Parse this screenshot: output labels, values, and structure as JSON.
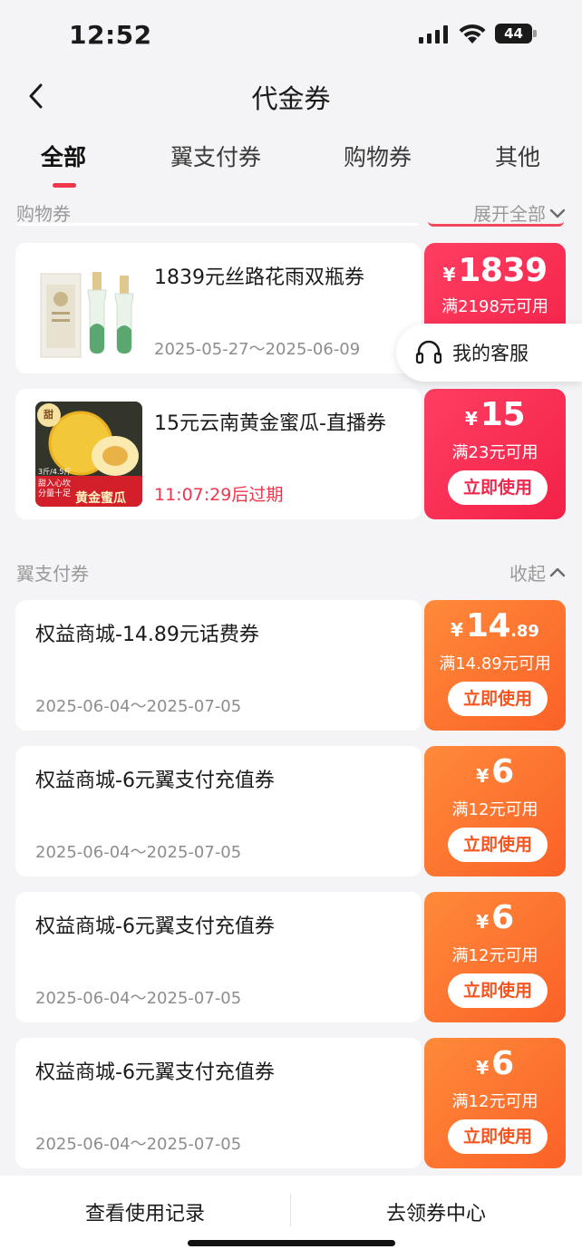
{
  "status": {
    "time": "12:52",
    "battery": "44"
  },
  "nav": {
    "title": "代金券"
  },
  "tabs": [
    {
      "label": "全部",
      "active": true
    },
    {
      "label": "翼支付券"
    },
    {
      "label": "购物券"
    },
    {
      "label": "其他"
    }
  ],
  "sections": {
    "shopping": {
      "title": "购物券",
      "action": "展开全部"
    },
    "pay": {
      "title": "翼支付券",
      "action": "收起"
    }
  },
  "shopping_coupons": [
    {
      "title": "1839元丝路花雨双瓶券",
      "date": "2025-05-27～2025-06-09",
      "symbol": "¥",
      "amount": "1839",
      "condition": "满2198元可用"
    },
    {
      "title": "15元云南黄金蜜瓜-直播券",
      "expire": "11:07:29后过期",
      "symbol": "¥",
      "amount": "15",
      "condition": "满23元可用",
      "button": "立即使用"
    }
  ],
  "pay_coupons": [
    {
      "title": "权益商城-14.89元话费券",
      "date": "2025-06-04～2025-07-05",
      "symbol": "¥",
      "amount": "14",
      "decimal": ".89",
      "condition": "满14.89元可用",
      "button": "立即使用"
    },
    {
      "title": "权益商城-6元翼支付充值券",
      "date": "2025-06-04～2025-07-05",
      "symbol": "¥",
      "amount": "6",
      "condition": "满12元可用",
      "button": "立即使用"
    },
    {
      "title": "权益商城-6元翼支付充值券",
      "date": "2025-06-04～2025-07-05",
      "symbol": "¥",
      "amount": "6",
      "condition": "满12元可用",
      "button": "立即使用"
    },
    {
      "title": "权益商城-6元翼支付充值券",
      "date": "2025-06-04～2025-07-05",
      "symbol": "¥",
      "amount": "6",
      "condition": "满12元可用",
      "button": "立即使用"
    }
  ],
  "melon_image": {
    "tags": [
      "甜",
      "3斤/4.5斤",
      "甜入心坎 分量十足"
    ],
    "banner": "黄金蜜瓜"
  },
  "service": {
    "label": "我的客服"
  },
  "bottom": {
    "records": "查看使用记录",
    "center": "去领券中心"
  },
  "colors": {
    "accent": "#f0364d",
    "red_gradient": "#f32148",
    "orange_gradient": "#fb6127"
  }
}
